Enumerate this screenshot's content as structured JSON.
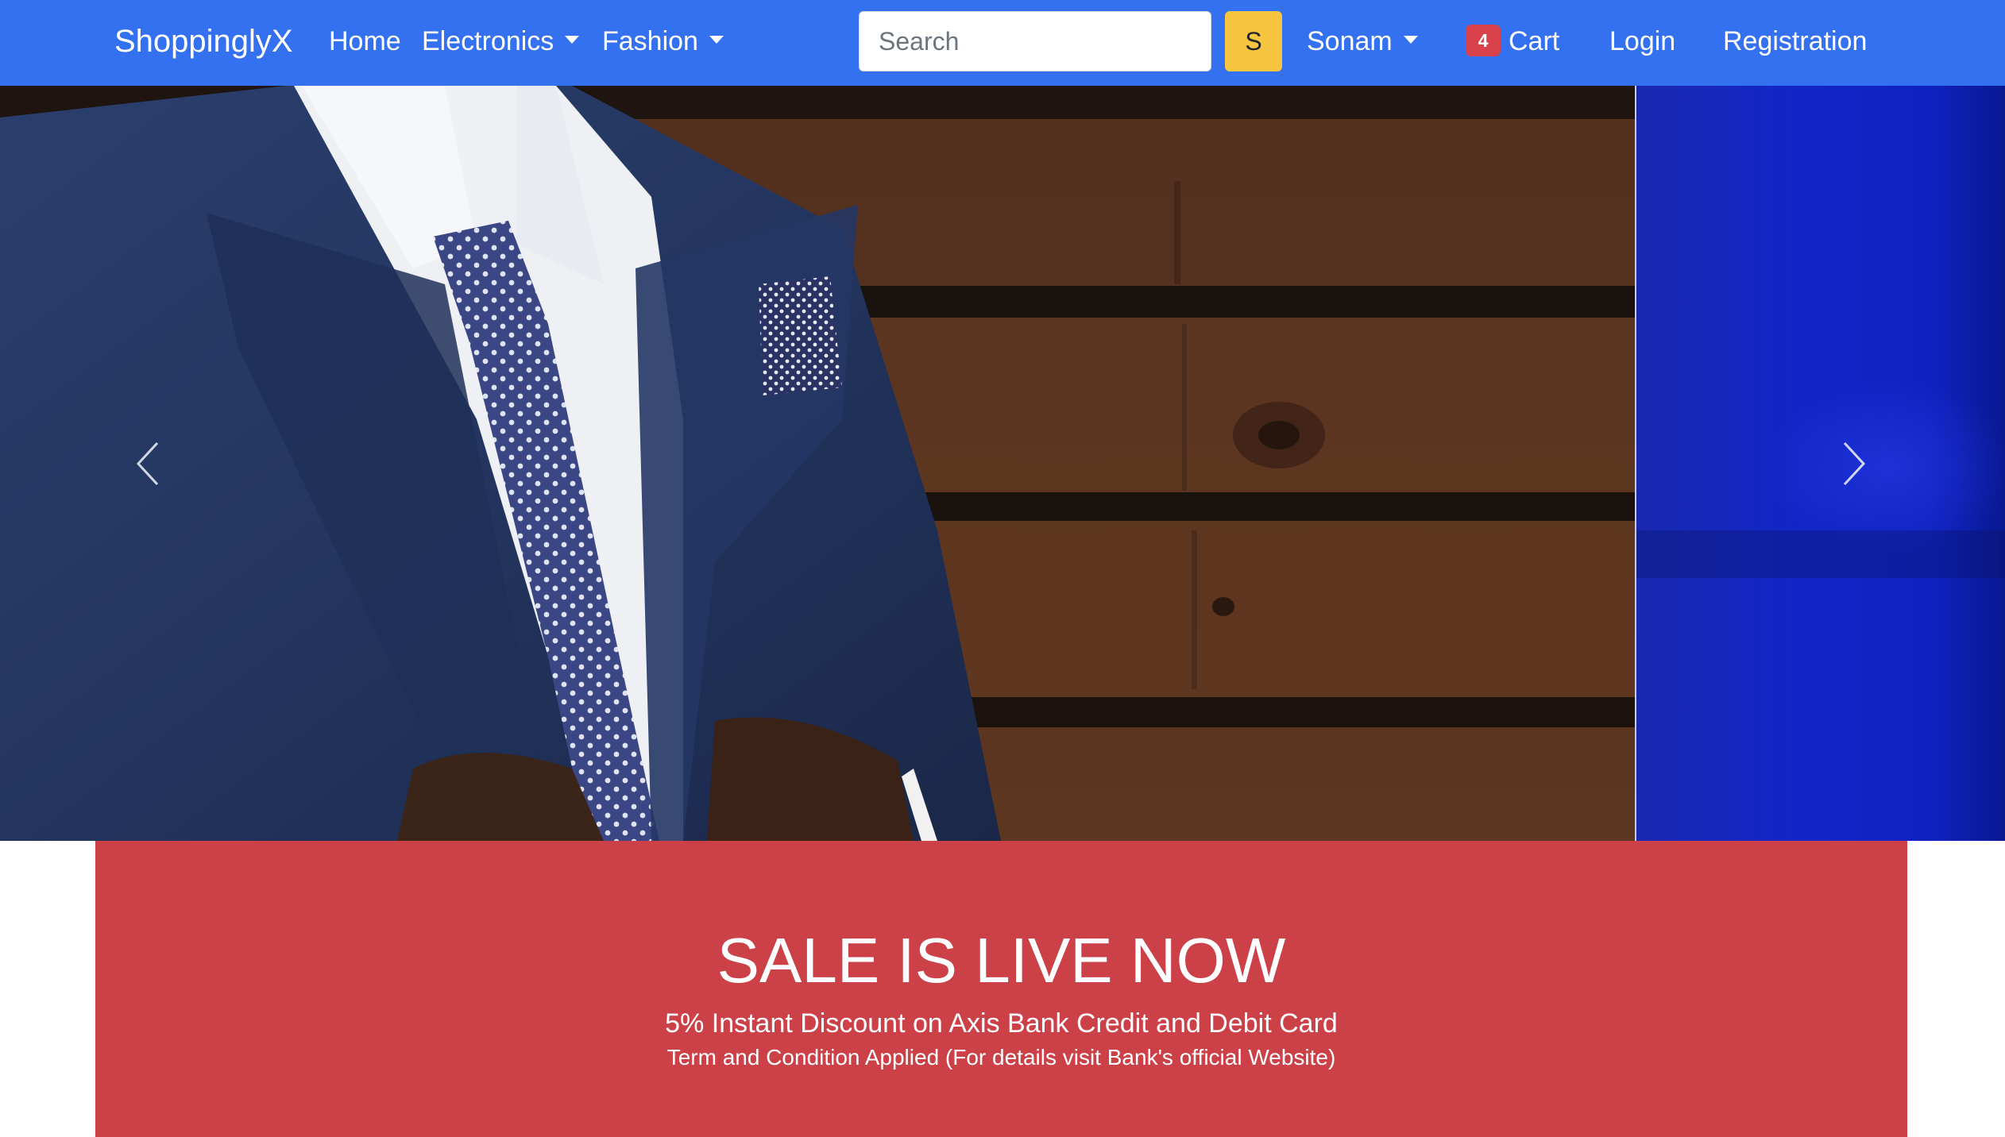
{
  "navbar": {
    "brand": "ShoppinglyX",
    "home": "Home",
    "electronics": "Electronics",
    "fashion": "Fashion",
    "search_placeholder": "Search",
    "search_button": "S",
    "user": "Sonam",
    "cart_count": "4",
    "cart": "Cart",
    "login": "Login",
    "registration": "Registration"
  },
  "carousel": {
    "prev_icon": "chevron-left-icon",
    "next_icon": "chevron-right-icon"
  },
  "sale": {
    "title": "SALE IS LIVE NOW",
    "subtitle": "5% Instant Discount on Axis Bank Credit and Debit Card",
    "terms": "Term and Condition Applied (For details visit Bank's official Website)"
  },
  "colors": {
    "navbar": "#3471f0",
    "search_button": "#f7c540",
    "cart_badge": "#d9424a",
    "sale_banner": "#cc4148"
  }
}
